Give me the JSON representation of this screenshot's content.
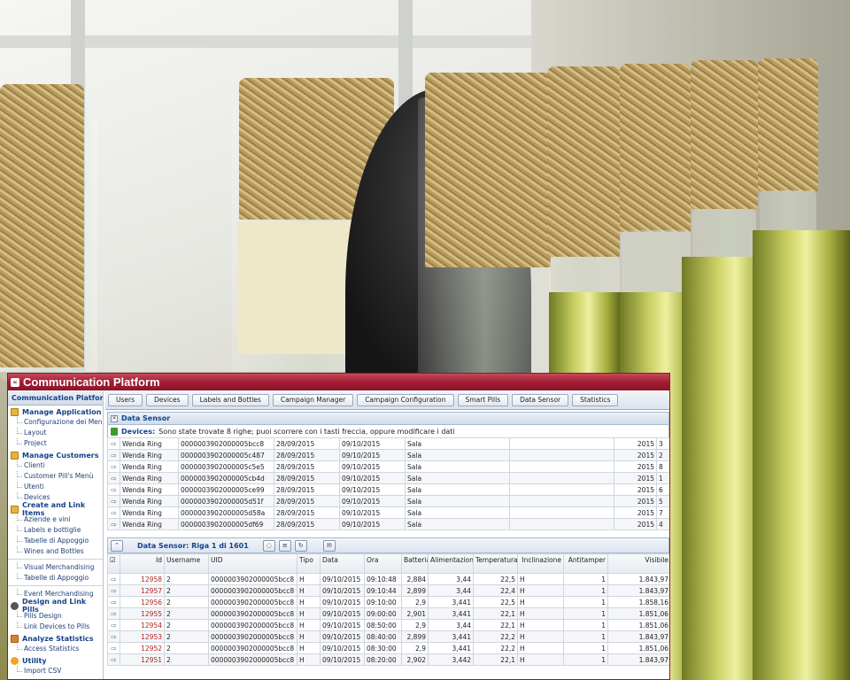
{
  "app": {
    "title": "Communication Platform",
    "collapse_icon": "double-chevron-left-icon"
  },
  "sidebar": {
    "header": "Communication Platform M - Di",
    "groups": [
      {
        "label": "Manage Application",
        "icon": "folder-icon",
        "items": [
          "Configurazione dei Menu Pills",
          "Layout",
          "Project"
        ]
      },
      {
        "label": "Manage Customers",
        "icon": "folder-icon",
        "items": [
          "Clienti",
          "Customer Pill's Menù",
          "Utenti",
          "Devices"
        ]
      },
      {
        "label": "Create and Link Items",
        "icon": "folder-icon",
        "items": [
          "Aziende e vini",
          "Labels e bottiglie",
          "Tabelle di Appoggio",
          "Wines and Bottles",
          "Visual Merchandising",
          "Tabelle di Appoggio",
          "Event Merchandising"
        ]
      },
      {
        "label": "Design and Link Pills",
        "icon": "pill-icon",
        "items": [
          "Pills Design",
          "Link Devices to Pills"
        ]
      },
      {
        "label": "Analyze Statistics",
        "icon": "chart-icon",
        "items": [
          "Access Statistics"
        ]
      },
      {
        "label": "Utility",
        "icon": "tool-icon",
        "items": [
          "Import CSV"
        ]
      }
    ]
  },
  "tabs": [
    "Users",
    "Devices",
    "Labels and Bottles",
    "Campaign Manager",
    "Campaign Configuration",
    "Smart Pills",
    "Data Sensor",
    "Statistics"
  ],
  "panel": {
    "title": "Data Sensor",
    "info_label": "Devices:",
    "info_text": "Sono state trovate 8 righe; puoi scorrere con i tasti freccia, oppure modificare i dati"
  },
  "devices": [
    {
      "name": "Wenda Ring",
      "uid": "0000003902000005bcc8",
      "d1": "28/09/2015",
      "d2": "09/10/2015",
      "place": "Sala",
      "year": "2015",
      "n": "3"
    },
    {
      "name": "Wenda Ring",
      "uid": "0000003902000005c487",
      "d1": "28/09/2015",
      "d2": "09/10/2015",
      "place": "Sala",
      "year": "2015",
      "n": "2"
    },
    {
      "name": "Wenda Ring",
      "uid": "0000003902000005c5e5",
      "d1": "28/09/2015",
      "d2": "09/10/2015",
      "place": "Sala",
      "year": "2015",
      "n": "8"
    },
    {
      "name": "Wenda Ring",
      "uid": "0000003902000005cb4d",
      "d1": "28/09/2015",
      "d2": "09/10/2015",
      "place": "Sala",
      "year": "2015",
      "n": "1"
    },
    {
      "name": "Wenda Ring",
      "uid": "0000003902000005ce99",
      "d1": "28/09/2015",
      "d2": "09/10/2015",
      "place": "Sala",
      "year": "2015",
      "n": "6"
    },
    {
      "name": "Wenda Ring",
      "uid": "0000003902000005d51f",
      "d1": "28/09/2015",
      "d2": "09/10/2015",
      "place": "Sala",
      "year": "2015",
      "n": "5"
    },
    {
      "name": "Wenda Ring",
      "uid": "0000003902000005d58a",
      "d1": "28/09/2015",
      "d2": "09/10/2015",
      "place": "Sala",
      "year": "2015",
      "n": "7"
    },
    {
      "name": "Wenda Ring",
      "uid": "0000003902000005df69",
      "d1": "28/09/2015",
      "d2": "09/10/2015",
      "place": "Sala",
      "year": "2015",
      "n": "4"
    }
  ],
  "sensor": {
    "title": "Data Sensor: Riga 1 di 1601",
    "columns": [
      "Id",
      "Username",
      "UID",
      "Tipo",
      "Data",
      "Ora",
      "Batteria",
      "Alimentazione",
      "Temperatura",
      "Inclinazione",
      "Antitamper",
      "Visibile"
    ],
    "rows": [
      [
        "12958",
        "2",
        "0000003902000005bcc8",
        "H",
        "09/10/2015",
        "09:10:48",
        "2,884",
        "3,44",
        "22,5",
        "H",
        "1",
        "1.843,97"
      ],
      [
        "12957",
        "2",
        "0000003902000005bcc8",
        "H",
        "09/10/2015",
        "09:10:44",
        "2,899",
        "3,44",
        "22,4",
        "H",
        "1",
        "1.843,97"
      ],
      [
        "12956",
        "2",
        "0000003902000005bcc8",
        "H",
        "09/10/2015",
        "09:10:00",
        "2,9",
        "3,441",
        "22,5",
        "H",
        "1",
        "1.858,16"
      ],
      [
        "12955",
        "2",
        "0000003902000005bcc8",
        "H",
        "09/10/2015",
        "09:00:00",
        "2,901",
        "3,441",
        "22,1",
        "H",
        "1",
        "1.851,06"
      ],
      [
        "12954",
        "2",
        "0000003902000005bcc8",
        "H",
        "09/10/2015",
        "08:50:00",
        "2,9",
        "3,44",
        "22,1",
        "H",
        "1",
        "1.851,06"
      ],
      [
        "12953",
        "2",
        "0000003902000005bcc8",
        "H",
        "09/10/2015",
        "08:40:00",
        "2,899",
        "3,441",
        "22,2",
        "H",
        "1",
        "1.843,97"
      ],
      [
        "12952",
        "2",
        "0000003902000005bcc8",
        "H",
        "09/10/2015",
        "08:30:00",
        "2,9",
        "3,441",
        "22,2",
        "H",
        "1",
        "1.851,06"
      ],
      [
        "12951",
        "2",
        "0000003902000005bcc8",
        "H",
        "09/10/2015",
        "08:20:00",
        "2,902",
        "3,442",
        "22,1",
        "H",
        "1",
        "1.843,97"
      ]
    ]
  },
  "colors": {
    "titlebar": "#a11d33",
    "link": "#15428b",
    "id_text": "#b22222"
  }
}
